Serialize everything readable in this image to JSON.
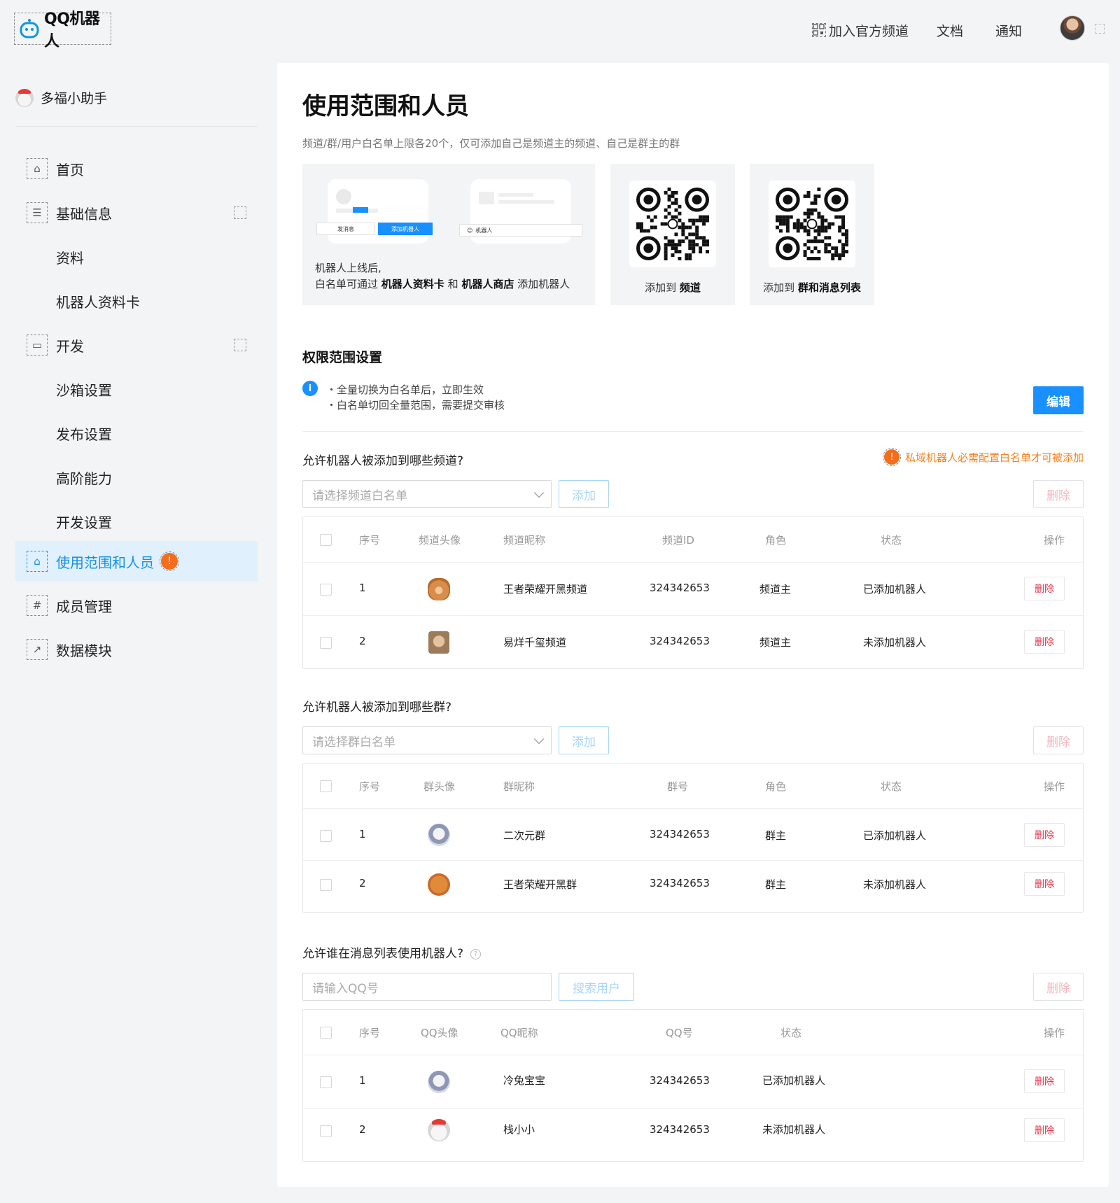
{
  "header": {
    "logo_text": "QQ机器人",
    "nav": [
      {
        "label": "加入官方频道",
        "icon": "qrcode-icon"
      },
      {
        "label": "文档"
      },
      {
        "label": "通知"
      }
    ]
  },
  "sidebar": {
    "bot_name": "多福小助手",
    "items": [
      {
        "label": "首页",
        "icon": "home-icon"
      },
      {
        "label": "基础信息",
        "icon": "info-doc-icon"
      },
      {
        "label": "资料"
      },
      {
        "label": "机器人资料卡"
      },
      {
        "label": "开发",
        "icon": "monitor-icon"
      },
      {
        "label": "沙箱设置"
      },
      {
        "label": "发布设置"
      },
      {
        "label": "高阶能力"
      },
      {
        "label": "开发设置"
      },
      {
        "label": "使用范围和人员",
        "icon": "bag-icon",
        "active": true,
        "badge": "!"
      },
      {
        "label": "成员管理",
        "icon": "hash-icon"
      },
      {
        "label": "数据模块",
        "icon": "chart-icon"
      }
    ]
  },
  "main": {
    "title": "使用范围和人员",
    "subtitle": "频道/群/用户白名单上限各20个，仅可添加自己是频道主的频道、自己是群主的群",
    "intro_card": {
      "mock_send_label": "发消息",
      "mock_add_label": "添加机器人",
      "mock_bot_label": "机器人",
      "text_line1": "机器人上线后,",
      "text_line2_prefix": "白名单可通过 ",
      "text_line2_bold1": "机器人资料卡",
      "text_line2_mid": " 和 ",
      "text_line2_bold2": "机器人商店",
      "text_line2_suffix": " 添加机器人"
    },
    "qr_cards": [
      {
        "prefix": "添加到 ",
        "bold": "频道"
      },
      {
        "prefix": "添加到 ",
        "bold": "群和消息列表"
      }
    ],
    "permission": {
      "title": "权限范围设置",
      "info_icon_text": "i",
      "info_lines": [
        "・全量切换为白名单后，立即生效",
        "・白名单切回全量范围，需要提交审核"
      ],
      "edit_label": "编辑"
    },
    "channels": {
      "question": "允许机器人被添加到哪些频道?",
      "warning_icon_text": "!",
      "warning": "私域机器人必需配置白名单才可被添加",
      "placeholder": "请选择频道白名单",
      "add_label": "添加",
      "delete_label": "删除",
      "headers": [
        "序号",
        "频道头像",
        "频道昵称",
        "频道ID",
        "角色",
        "状态",
        "操作"
      ],
      "rows": [
        {
          "index": "1",
          "avatar": "bear-avatar",
          "name": "王者荣耀开黑频道",
          "id": "324342653",
          "role": "频道主",
          "status": "已添加机器人",
          "action": "删除"
        },
        {
          "index": "2",
          "avatar": "man-avatar",
          "name": "易烊千玺频道",
          "id": "324342653",
          "role": "频道主",
          "status": "未添加机器人",
          "action": "删除"
        }
      ]
    },
    "groups": {
      "question": "允许机器人被添加到哪些群?",
      "placeholder": "请选择群白名单",
      "add_label": "添加",
      "delete_label": "删除",
      "headers": [
        "序号",
        "群头像",
        "群昵称",
        "群号",
        "角色",
        "状态",
        "操作"
      ],
      "rows": [
        {
          "index": "1",
          "avatar": "astronaut-avatar",
          "name": "二次元群",
          "id": "324342653",
          "role": "群主",
          "status": "已添加机器人",
          "action": "删除"
        },
        {
          "index": "2",
          "avatar": "cookie-avatar",
          "name": "王者荣耀开黑群",
          "id": "324342653",
          "role": "群主",
          "status": "未添加机器人",
          "action": "删除"
        }
      ]
    },
    "users": {
      "question": "允许谁在消息列表使用机器人?",
      "help_icon_text": "?",
      "placeholder": "请输入QQ号",
      "search_label": "搜索用户",
      "delete_label": "删除",
      "headers": [
        "序号",
        "QQ头像",
        "QQ昵称",
        "QQ号",
        "状态",
        "操作"
      ],
      "rows": [
        {
          "index": "1",
          "avatar": "astronaut-avatar",
          "name": "冷兔宝宝",
          "id": "324342653",
          "status": "已添加机器人",
          "action": "删除"
        },
        {
          "index": "2",
          "avatar": "polar-bear-avatar",
          "name": "栈小小",
          "id": "324342653",
          "status": "未添加机器人",
          "action": "删除"
        }
      ]
    }
  },
  "colors": {
    "primary": "#1890ff",
    "active_bg": "#e0f0fc",
    "warning": "#f5821f",
    "danger": "#e8334a"
  }
}
